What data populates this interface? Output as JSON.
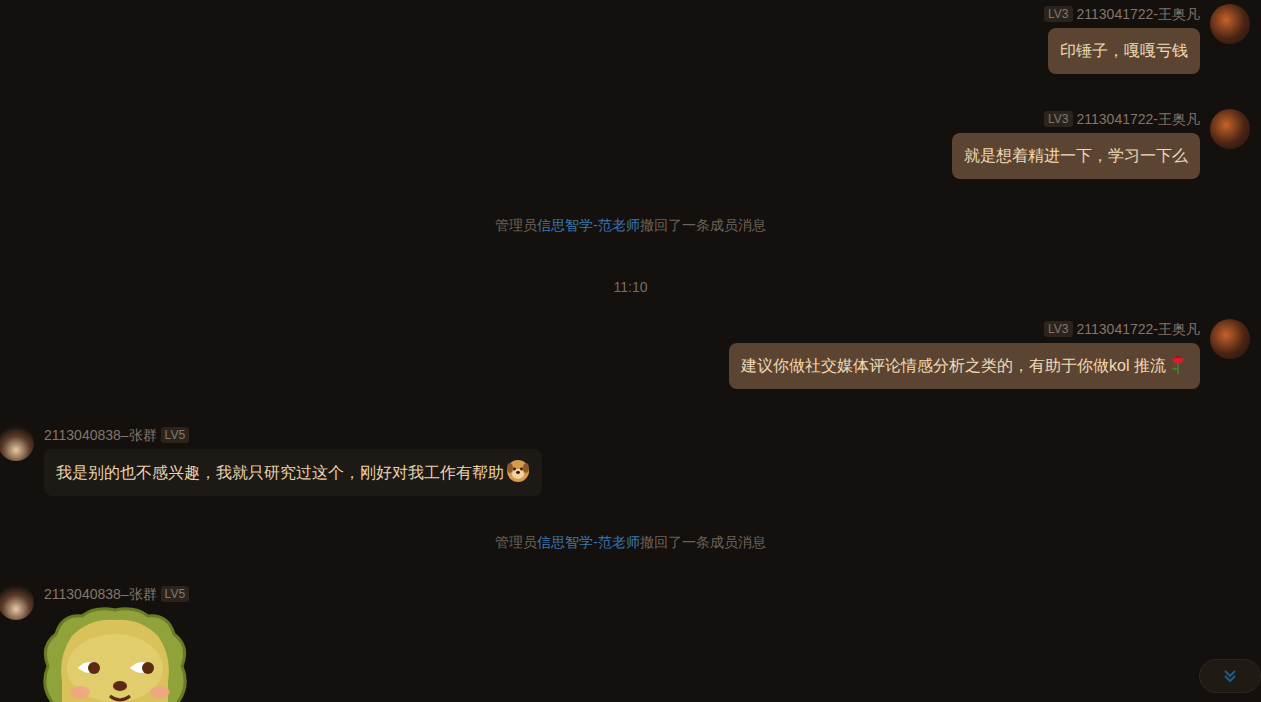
{
  "chat": {
    "messages": [
      {
        "kind": "outgoing",
        "sender": "2113041722-王奥凡",
        "level": "LV3",
        "text": "印锤子，嘎嘎亏钱",
        "emoji": "none"
      },
      {
        "kind": "outgoing",
        "sender": "2113041722-王奥凡",
        "level": "LV3",
        "text": "就是想着精进一下，学习一下么",
        "emoji": "none"
      },
      {
        "kind": "system",
        "admin_label": "管理员",
        "admin": "信思智学-范老师",
        "action": "撤回了一条成员消息"
      },
      {
        "kind": "time",
        "text": "11:10"
      },
      {
        "kind": "outgoing",
        "sender": "2113041722-王奥凡",
        "level": "LV3",
        "text": "建议你做社交媒体评论情感分析之类的，有助于你做kol 推流",
        "emoji": "rose"
      },
      {
        "kind": "incoming",
        "sender": "2113040838–张群",
        "level": "LV5",
        "text": "我是别的也不感兴趣，我就只研究过这个，刚好对我工作有帮助",
        "emoji": "dog"
      },
      {
        "kind": "system",
        "admin_label": "管理员",
        "admin": "信思智学-范老师",
        "action": "撤回了一条成员消息"
      },
      {
        "kind": "sticker",
        "sender": "2113040838–张群",
        "level": "LV5"
      }
    ]
  }
}
